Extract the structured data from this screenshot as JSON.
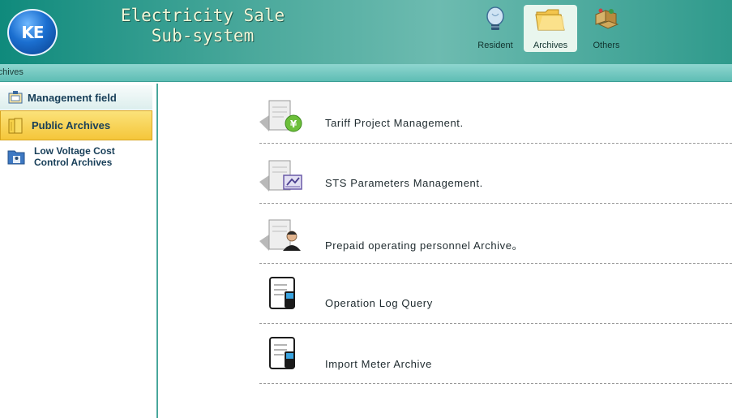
{
  "header": {
    "logo_text": "KE",
    "title_line1": "Electricity Sale",
    "title_line2": "Sub-system",
    "nav": [
      {
        "label": "Resident",
        "icon": "lightbulb-icon"
      },
      {
        "label": "Archives",
        "icon": "folder-icon",
        "active": true
      },
      {
        "label": "Others",
        "icon": "boxes-icon"
      }
    ]
  },
  "breadcrumb": "rchives",
  "sidebar": {
    "heading": "Management field",
    "items": [
      {
        "label": "Public Archives",
        "active": true,
        "icon": "public-archives-icon"
      },
      {
        "label_line1": "Low Voltage Cost",
        "label_line2": "Control Archives",
        "icon": "low-voltage-archives-icon"
      }
    ]
  },
  "main": {
    "items": [
      {
        "label": "Tariff Project Management.",
        "icon": "tariff-document-icon"
      },
      {
        "label": "STS Parameters Management.",
        "icon": "sts-parameters-icon"
      },
      {
        "label": "Prepaid operating personnel Archive。",
        "icon": "personnel-document-icon"
      },
      {
        "label": "Operation Log Query",
        "icon": "operation-log-icon"
      },
      {
        "label": "Import Meter Archive",
        "icon": "import-meter-icon"
      }
    ]
  },
  "colors": {
    "header_teal": "#0f8a7c",
    "crumb_bar": "#6cc6bd",
    "sidebar_active": "#f5c63a",
    "sidebar_border": "#48a79b"
  }
}
